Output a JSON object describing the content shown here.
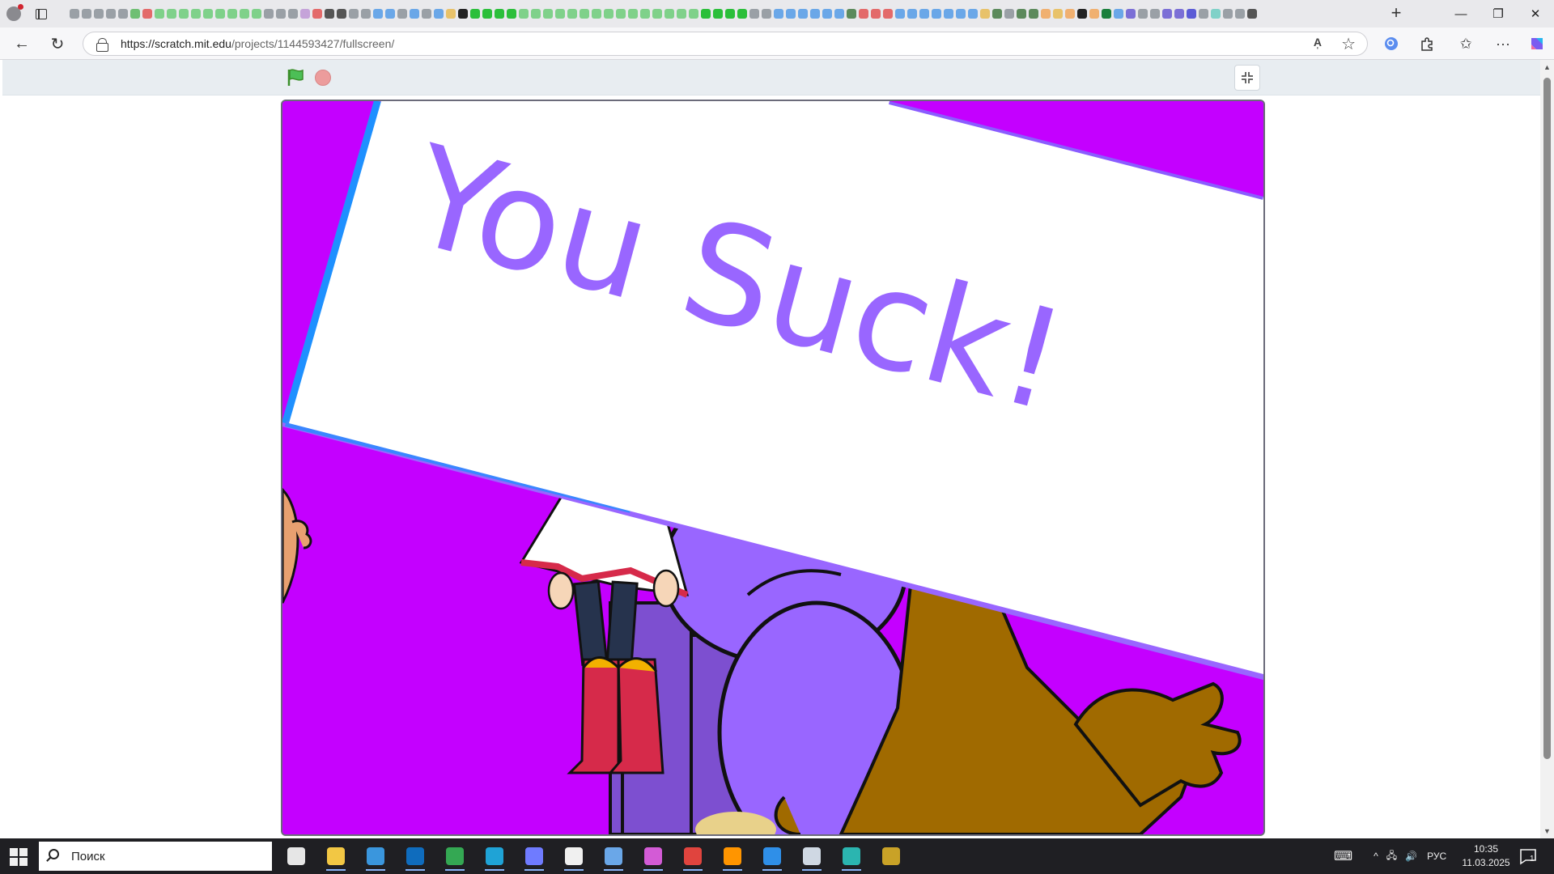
{
  "browser": {
    "url_host": "https://scratch.mit.edu",
    "url_path": "/projects/1144593427/fullscreen/",
    "read_aloud_label": "A̩",
    "tab_favicon_colors": [
      "#9aa0a6",
      "#9aa0a6",
      "#9aa0a6",
      "#9aa0a6",
      "#9aa0a6",
      "#6fbf73",
      "#e36a6a",
      "#7fd18a",
      "#7fd18a",
      "#7fd18a",
      "#7fd18a",
      "#7fd18a",
      "#7fd18a",
      "#7fd18a",
      "#7fd18a",
      "#7fd18a",
      "#9aa0a6",
      "#9aa0a6",
      "#9aa0a6",
      "#c5a3d9",
      "#e36a6a",
      "#555",
      "#555",
      "#9aa0a6",
      "#9aa0a6",
      "#6aa7e8",
      "#6aa7e8",
      "#9aa0a6",
      "#6aa7e8",
      "#9aa0a6",
      "#6aa7e8",
      "#e8c26a",
      "#222",
      "#2bbf3a",
      "#2bbf3a",
      "#2bbf3a",
      "#2bbf3a",
      "#7fd18a",
      "#7fd18a",
      "#7fd18a",
      "#7fd18a",
      "#7fd18a",
      "#7fd18a",
      "#7fd18a",
      "#7fd18a",
      "#7fd18a",
      "#7fd18a",
      "#7fd18a",
      "#7fd18a",
      "#7fd18a",
      "#7fd18a",
      "#7fd18a",
      "#2bbf3a",
      "#2bbf3a",
      "#2bbf3a",
      "#2bbf3a",
      "#9aa0a6",
      "#9aa0a6",
      "#6aa7e8",
      "#6aa7e8",
      "#6aa7e8",
      "#6aa7e8",
      "#6aa7e8",
      "#6aa7e8",
      "#5c8a5c",
      "#e36a6a",
      "#e36a6a",
      "#e36a6a",
      "#6aa7e8",
      "#6aa7e8",
      "#6aa7e8",
      "#6aa7e8",
      "#6aa7e8",
      "#6aa7e8",
      "#6aa7e8",
      "#e8c26a",
      "#5c8a5c",
      "#9aa0a6",
      "#5c8a5c",
      "#5c8a5c",
      "#f0b070",
      "#e8c26a",
      "#f0b070",
      "#222",
      "#f0b070",
      "#1a7f3c",
      "#6aa7e8",
      "#7b6fd6",
      "#9aa0a6",
      "#9aa0a6",
      "#7b6fd6",
      "#7b6fd6",
      "#5b5bd6",
      "#9aa0a6",
      "#7fd1c8",
      "#9aa0a6",
      "#9aa0a6",
      "#555"
    ]
  },
  "stage": {
    "banner_text": "You Suck!",
    "banner_text_color": "#9966ff",
    "background_color": "#c400ff",
    "banner_edge_color": "#1e90ff"
  },
  "taskbar": {
    "search_placeholder": "Поиск",
    "lang": "РУС",
    "time": "10:35",
    "date": "11.03.2025",
    "notification_count": "1",
    "apps": [
      {
        "name": "task-view",
        "color": "#e6e6e6"
      },
      {
        "name": "file-explorer",
        "color": "#f2c744"
      },
      {
        "name": "ms-store",
        "color": "#3a96dd"
      },
      {
        "name": "outlook",
        "color": "#0f6cbd"
      },
      {
        "name": "chrome",
        "color": "#34a853"
      },
      {
        "name": "edge",
        "color": "#1fa3d6"
      },
      {
        "name": "app-a",
        "color": "#6f7bff"
      },
      {
        "name": "app-f",
        "color": "#f0f0f0"
      },
      {
        "name": "notepad-app",
        "color": "#6aa7e8"
      },
      {
        "name": "drop-app",
        "color": "#d35bd6"
      },
      {
        "name": "record-app",
        "color": "#e0443e"
      },
      {
        "name": "firefox",
        "color": "#ff9500"
      },
      {
        "name": "paint-app",
        "color": "#2f8fe8"
      },
      {
        "name": "viewer-app",
        "color": "#cfd8e3"
      },
      {
        "name": "x-app",
        "color": "#2bb5b0"
      },
      {
        "name": "warrior-app",
        "color": "#c9a227"
      }
    ]
  }
}
